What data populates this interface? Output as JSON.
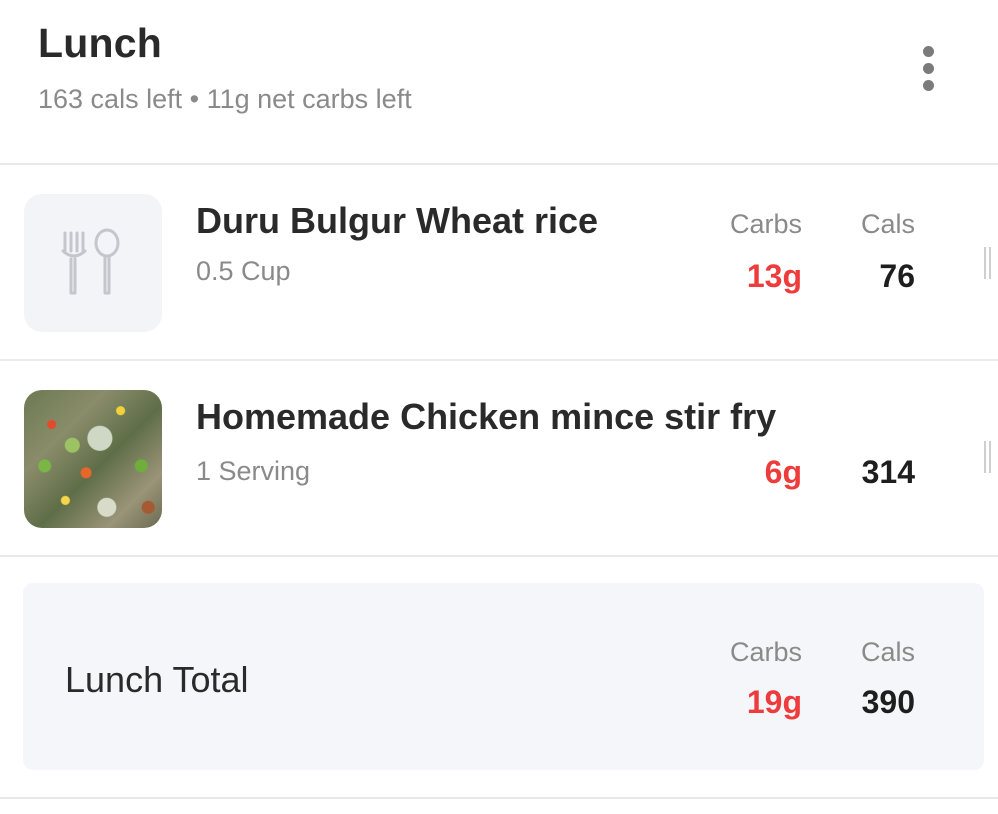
{
  "meal": {
    "title": "Lunch",
    "summary": {
      "cals_left": "163 cals left",
      "separator": "•",
      "carbs_left": "11g net carbs left"
    },
    "more_icon": "more-vertical-icon"
  },
  "columns": {
    "carbs": "Carbs",
    "cals": "Cals"
  },
  "foods": [
    {
      "name": "Duru Bulgur Wheat rice",
      "serving": "0.5 Cup",
      "carbs": "13g",
      "cals": "76",
      "thumbnail": "fork-spoon-icon",
      "show_column_labels": true
    },
    {
      "name": "Homemade Chicken mince stir fry",
      "serving": "1 Serving",
      "carbs": "6g",
      "cals": "314",
      "thumbnail": "food-photo",
      "show_column_labels": false
    }
  ],
  "total": {
    "label": "Lunch Total",
    "carbs": "19g",
    "cals": "390"
  },
  "colors": {
    "carbs": "#ee3b3b",
    "muted_text": "#8a8a8a",
    "card_bg": "#f4f6fa",
    "placeholder_bg": "#f3f4f7"
  }
}
